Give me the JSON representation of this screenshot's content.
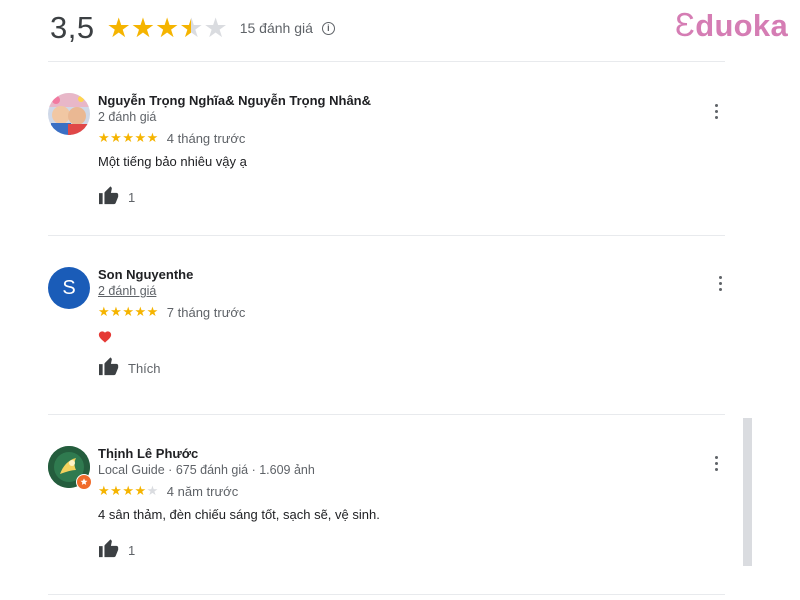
{
  "summary": {
    "score": "3,5",
    "rating": 3.5,
    "count_label": "15 đánh giá",
    "info_icon": "info-icon"
  },
  "brand": {
    "mark": "Ɛ",
    "name": "duoka"
  },
  "reviews": [
    {
      "name": "Nguyễn Trọng Nghĩa& Nguyễn Trọng Nhân&",
      "meta": "2 đánh giá",
      "stars": 5,
      "time": "4 tháng trước",
      "text": "Một tiếng bảo nhiêu vậy ạ",
      "likes": "1"
    },
    {
      "name": "Son Nguyenthe",
      "meta": "2 đánh giá",
      "avatar_letter": "S",
      "stars": 5,
      "time": "7 tháng trước",
      "like_label": "Thích"
    },
    {
      "name": "Thịnh Lê Phước",
      "meta": "Local Guide · 675 đánh giá · 1.609 ảnh",
      "stars": 4,
      "time": "4 năm trước",
      "text": "4 sân thảm, đèn chiếu sáng tốt, sạch sẽ, vệ sinh.",
      "likes": "1"
    }
  ],
  "colors": {
    "star": "#f5b400",
    "brand": "#d57db4",
    "avatar_blue": "#1a5cb8"
  }
}
